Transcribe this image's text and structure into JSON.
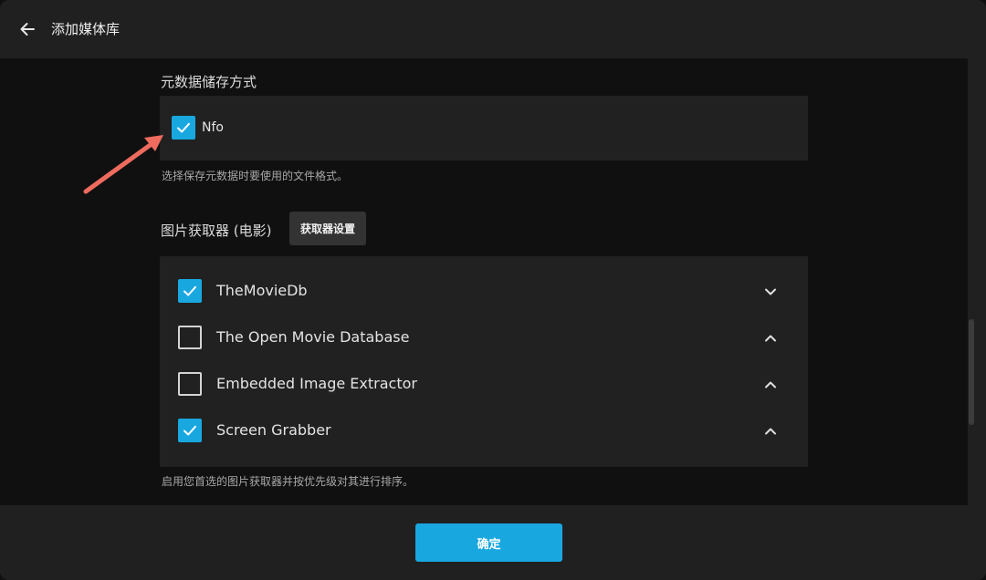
{
  "header": {
    "title": "添加媒体库",
    "back_icon": "arrow-left-icon"
  },
  "metadata_savers": {
    "label": "元数据储存方式",
    "options": [
      {
        "label": "Nfo",
        "checked": true
      }
    ],
    "help": "选择保存元数据时要使用的文件格式。"
  },
  "image_fetchers": {
    "label": "图片获取器 (电影)",
    "settings_button": "获取器设置",
    "items": [
      {
        "label": "TheMovieDb",
        "checked": true,
        "chevron": "down"
      },
      {
        "label": "The Open Movie Database",
        "checked": false,
        "chevron": "up"
      },
      {
        "label": "Embedded Image Extractor",
        "checked": false,
        "chevron": "up"
      },
      {
        "label": "Screen Grabber",
        "checked": true,
        "chevron": "up"
      }
    ],
    "help": "启用您首选的图片获取器并按优先级对其进行排序。"
  },
  "footer": {
    "ok_button": "确定"
  },
  "colors": {
    "accent": "#19a7e0",
    "annotation_arrow": "#ee6b5e"
  }
}
